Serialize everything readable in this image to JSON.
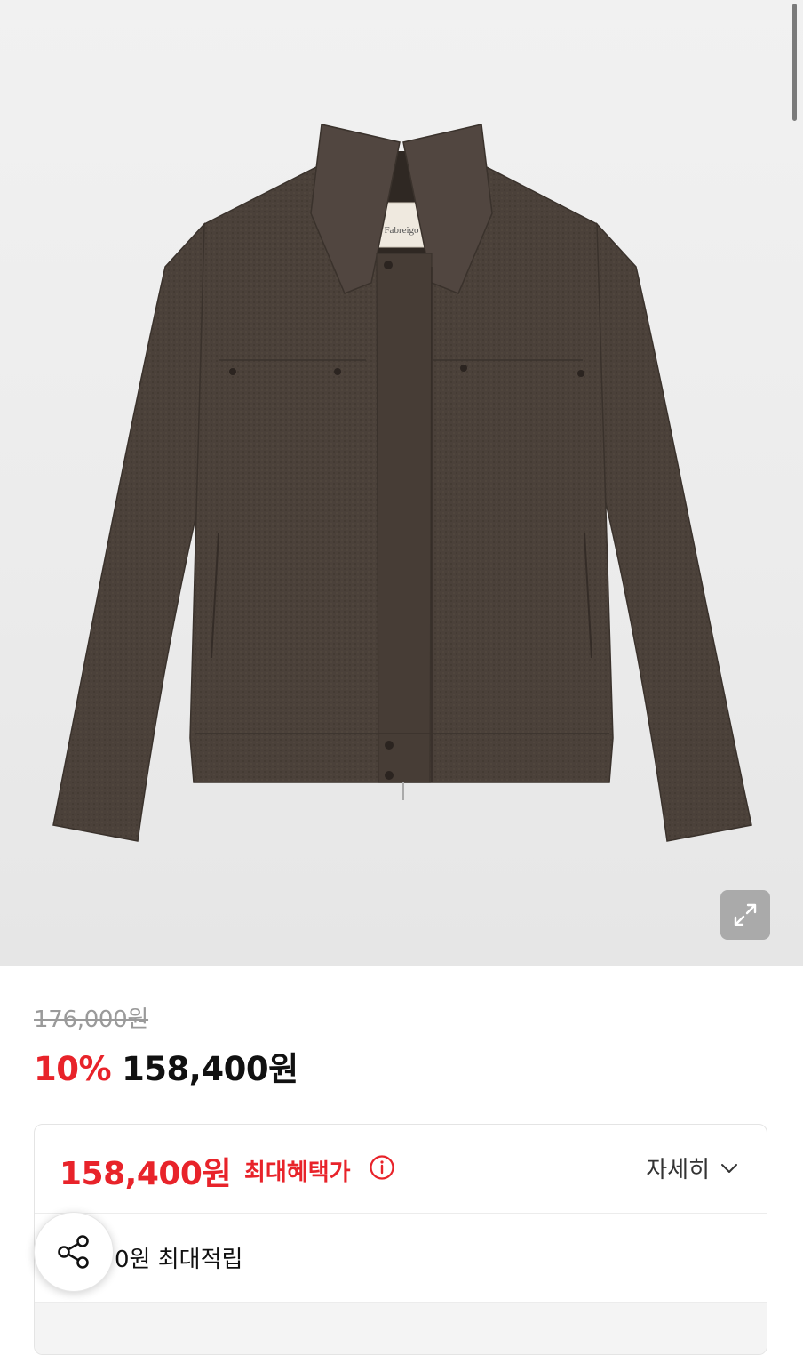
{
  "product": {
    "image_alt": "product-jacket-image",
    "label_text": "Fabreigo"
  },
  "pricing": {
    "original_price": "176,000원",
    "discount": "10%",
    "sale_price": "158,400원"
  },
  "benefit": {
    "max_price": "158,400원",
    "max_label": "최대혜택가",
    "detail_label": "자세히",
    "points_text": "0원 최대적립"
  },
  "icons": {
    "expand": "expand-icon",
    "info": "info-icon",
    "chevron": "chevron-down-icon",
    "share": "share-icon"
  },
  "colors": {
    "accent_red": "#e8232a",
    "jacket": "#4a4039",
    "background": "#ececec"
  }
}
